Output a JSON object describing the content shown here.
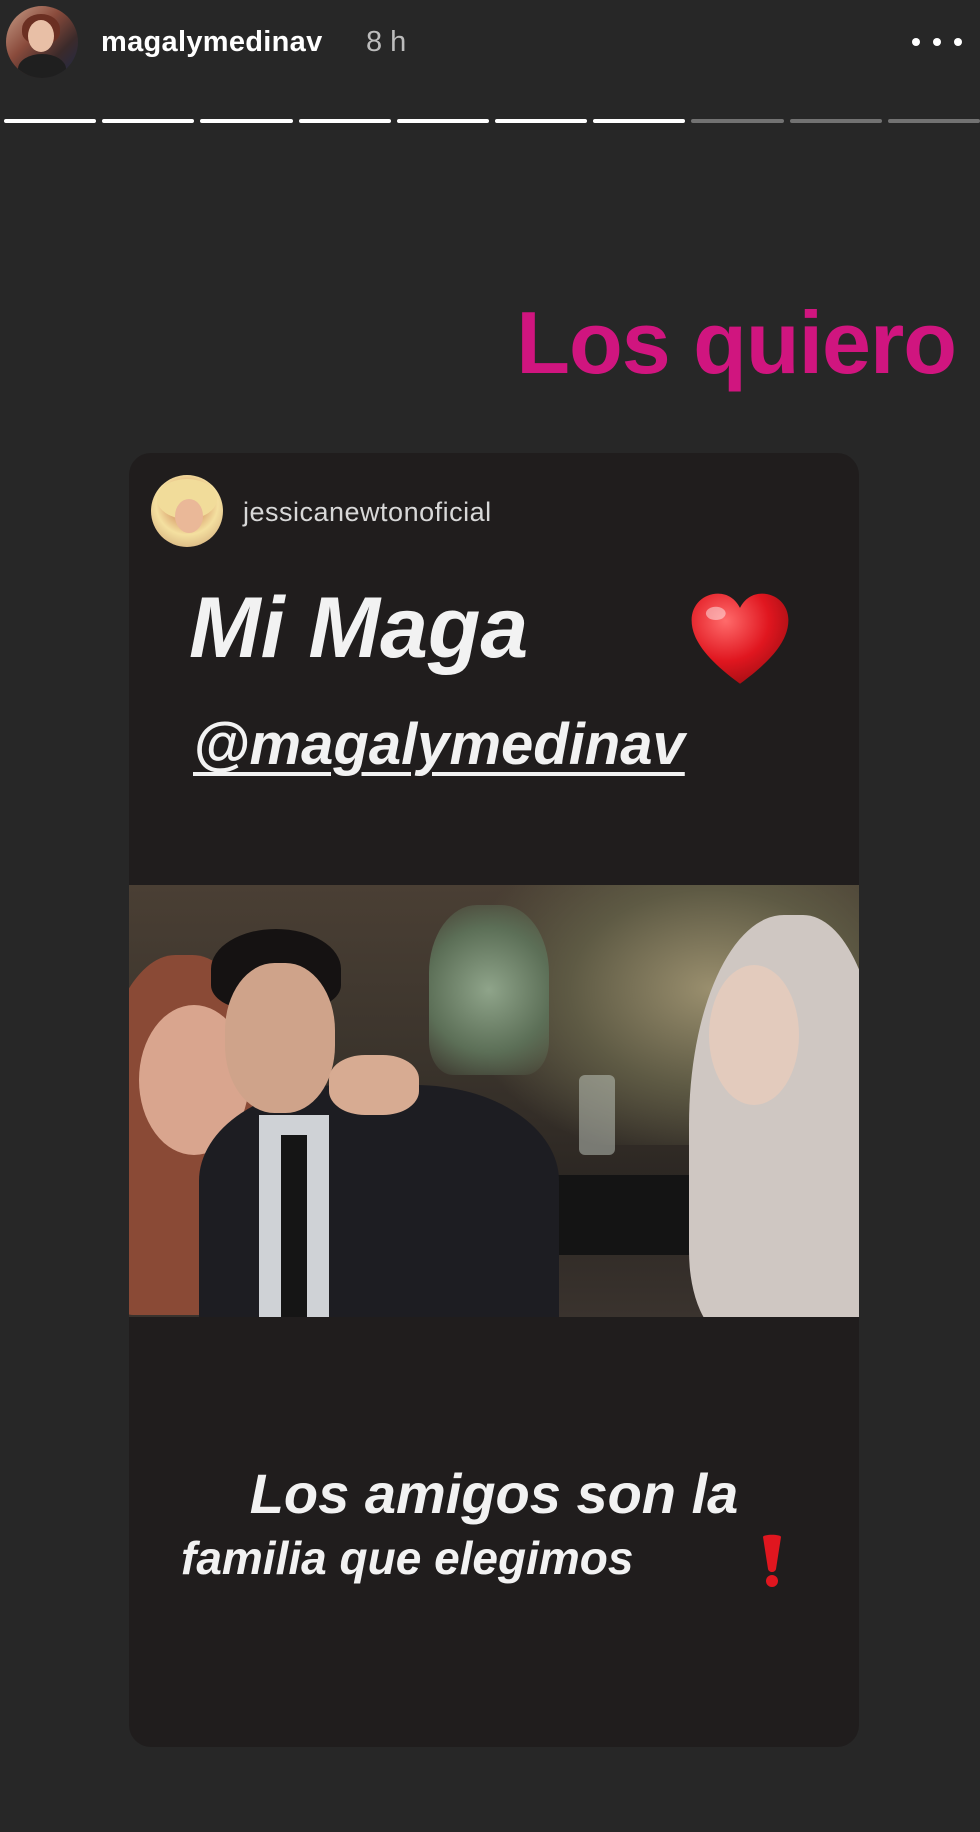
{
  "header": {
    "username": "magalymedinav",
    "time": "8 h",
    "more_icon": "more-horizontal-icon",
    "progress": {
      "total_segments": 10,
      "completed_segments": 7
    }
  },
  "story": {
    "caption": "Los quiero",
    "caption_color": "#d0157f"
  },
  "shared_post": {
    "username": "jessicanewtonoficial",
    "title": "Mi Maga",
    "title_emoji": "red-heart-icon",
    "mention": "@magalymedinav",
    "footer_line_1": "Los amigos son la",
    "footer_line_2": "familia que elegimos",
    "footer_emoji": "red-exclamation-icon"
  },
  "colors": {
    "background": "#272727",
    "card_background": "#201d1d",
    "accent": "#d0157f",
    "heart": "#e0161f"
  }
}
